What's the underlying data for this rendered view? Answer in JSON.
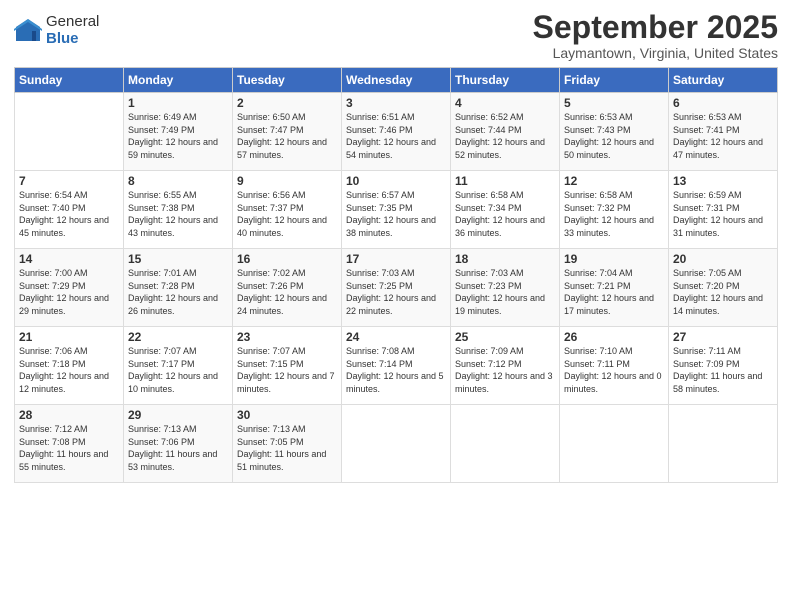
{
  "logo": {
    "general": "General",
    "blue": "Blue"
  },
  "title": "September 2025",
  "location": "Laymantown, Virginia, United States",
  "weekdays": [
    "Sunday",
    "Monday",
    "Tuesday",
    "Wednesday",
    "Thursday",
    "Friday",
    "Saturday"
  ],
  "weeks": [
    [
      {
        "day": "",
        "sunrise": "",
        "sunset": "",
        "daylight": ""
      },
      {
        "day": "1",
        "sunrise": "Sunrise: 6:49 AM",
        "sunset": "Sunset: 7:49 PM",
        "daylight": "Daylight: 12 hours and 59 minutes."
      },
      {
        "day": "2",
        "sunrise": "Sunrise: 6:50 AM",
        "sunset": "Sunset: 7:47 PM",
        "daylight": "Daylight: 12 hours and 57 minutes."
      },
      {
        "day": "3",
        "sunrise": "Sunrise: 6:51 AM",
        "sunset": "Sunset: 7:46 PM",
        "daylight": "Daylight: 12 hours and 54 minutes."
      },
      {
        "day": "4",
        "sunrise": "Sunrise: 6:52 AM",
        "sunset": "Sunset: 7:44 PM",
        "daylight": "Daylight: 12 hours and 52 minutes."
      },
      {
        "day": "5",
        "sunrise": "Sunrise: 6:53 AM",
        "sunset": "Sunset: 7:43 PM",
        "daylight": "Daylight: 12 hours and 50 minutes."
      },
      {
        "day": "6",
        "sunrise": "Sunrise: 6:53 AM",
        "sunset": "Sunset: 7:41 PM",
        "daylight": "Daylight: 12 hours and 47 minutes."
      }
    ],
    [
      {
        "day": "7",
        "sunrise": "Sunrise: 6:54 AM",
        "sunset": "Sunset: 7:40 PM",
        "daylight": "Daylight: 12 hours and 45 minutes."
      },
      {
        "day": "8",
        "sunrise": "Sunrise: 6:55 AM",
        "sunset": "Sunset: 7:38 PM",
        "daylight": "Daylight: 12 hours and 43 minutes."
      },
      {
        "day": "9",
        "sunrise": "Sunrise: 6:56 AM",
        "sunset": "Sunset: 7:37 PM",
        "daylight": "Daylight: 12 hours and 40 minutes."
      },
      {
        "day": "10",
        "sunrise": "Sunrise: 6:57 AM",
        "sunset": "Sunset: 7:35 PM",
        "daylight": "Daylight: 12 hours and 38 minutes."
      },
      {
        "day": "11",
        "sunrise": "Sunrise: 6:58 AM",
        "sunset": "Sunset: 7:34 PM",
        "daylight": "Daylight: 12 hours and 36 minutes."
      },
      {
        "day": "12",
        "sunrise": "Sunrise: 6:58 AM",
        "sunset": "Sunset: 7:32 PM",
        "daylight": "Daylight: 12 hours and 33 minutes."
      },
      {
        "day": "13",
        "sunrise": "Sunrise: 6:59 AM",
        "sunset": "Sunset: 7:31 PM",
        "daylight": "Daylight: 12 hours and 31 minutes."
      }
    ],
    [
      {
        "day": "14",
        "sunrise": "Sunrise: 7:00 AM",
        "sunset": "Sunset: 7:29 PM",
        "daylight": "Daylight: 12 hours and 29 minutes."
      },
      {
        "day": "15",
        "sunrise": "Sunrise: 7:01 AM",
        "sunset": "Sunset: 7:28 PM",
        "daylight": "Daylight: 12 hours and 26 minutes."
      },
      {
        "day": "16",
        "sunrise": "Sunrise: 7:02 AM",
        "sunset": "Sunset: 7:26 PM",
        "daylight": "Daylight: 12 hours and 24 minutes."
      },
      {
        "day": "17",
        "sunrise": "Sunrise: 7:03 AM",
        "sunset": "Sunset: 7:25 PM",
        "daylight": "Daylight: 12 hours and 22 minutes."
      },
      {
        "day": "18",
        "sunrise": "Sunrise: 7:03 AM",
        "sunset": "Sunset: 7:23 PM",
        "daylight": "Daylight: 12 hours and 19 minutes."
      },
      {
        "day": "19",
        "sunrise": "Sunrise: 7:04 AM",
        "sunset": "Sunset: 7:21 PM",
        "daylight": "Daylight: 12 hours and 17 minutes."
      },
      {
        "day": "20",
        "sunrise": "Sunrise: 7:05 AM",
        "sunset": "Sunset: 7:20 PM",
        "daylight": "Daylight: 12 hours and 14 minutes."
      }
    ],
    [
      {
        "day": "21",
        "sunrise": "Sunrise: 7:06 AM",
        "sunset": "Sunset: 7:18 PM",
        "daylight": "Daylight: 12 hours and 12 minutes."
      },
      {
        "day": "22",
        "sunrise": "Sunrise: 7:07 AM",
        "sunset": "Sunset: 7:17 PM",
        "daylight": "Daylight: 12 hours and 10 minutes."
      },
      {
        "day": "23",
        "sunrise": "Sunrise: 7:07 AM",
        "sunset": "Sunset: 7:15 PM",
        "daylight": "Daylight: 12 hours and 7 minutes."
      },
      {
        "day": "24",
        "sunrise": "Sunrise: 7:08 AM",
        "sunset": "Sunset: 7:14 PM",
        "daylight": "Daylight: 12 hours and 5 minutes."
      },
      {
        "day": "25",
        "sunrise": "Sunrise: 7:09 AM",
        "sunset": "Sunset: 7:12 PM",
        "daylight": "Daylight: 12 hours and 3 minutes."
      },
      {
        "day": "26",
        "sunrise": "Sunrise: 7:10 AM",
        "sunset": "Sunset: 7:11 PM",
        "daylight": "Daylight: 12 hours and 0 minutes."
      },
      {
        "day": "27",
        "sunrise": "Sunrise: 7:11 AM",
        "sunset": "Sunset: 7:09 PM",
        "daylight": "Daylight: 11 hours and 58 minutes."
      }
    ],
    [
      {
        "day": "28",
        "sunrise": "Sunrise: 7:12 AM",
        "sunset": "Sunset: 7:08 PM",
        "daylight": "Daylight: 11 hours and 55 minutes."
      },
      {
        "day": "29",
        "sunrise": "Sunrise: 7:13 AM",
        "sunset": "Sunset: 7:06 PM",
        "daylight": "Daylight: 11 hours and 53 minutes."
      },
      {
        "day": "30",
        "sunrise": "Sunrise: 7:13 AM",
        "sunset": "Sunset: 7:05 PM",
        "daylight": "Daylight: 11 hours and 51 minutes."
      },
      {
        "day": "",
        "sunrise": "",
        "sunset": "",
        "daylight": ""
      },
      {
        "day": "",
        "sunrise": "",
        "sunset": "",
        "daylight": ""
      },
      {
        "day": "",
        "sunrise": "",
        "sunset": "",
        "daylight": ""
      },
      {
        "day": "",
        "sunrise": "",
        "sunset": "",
        "daylight": ""
      }
    ]
  ]
}
